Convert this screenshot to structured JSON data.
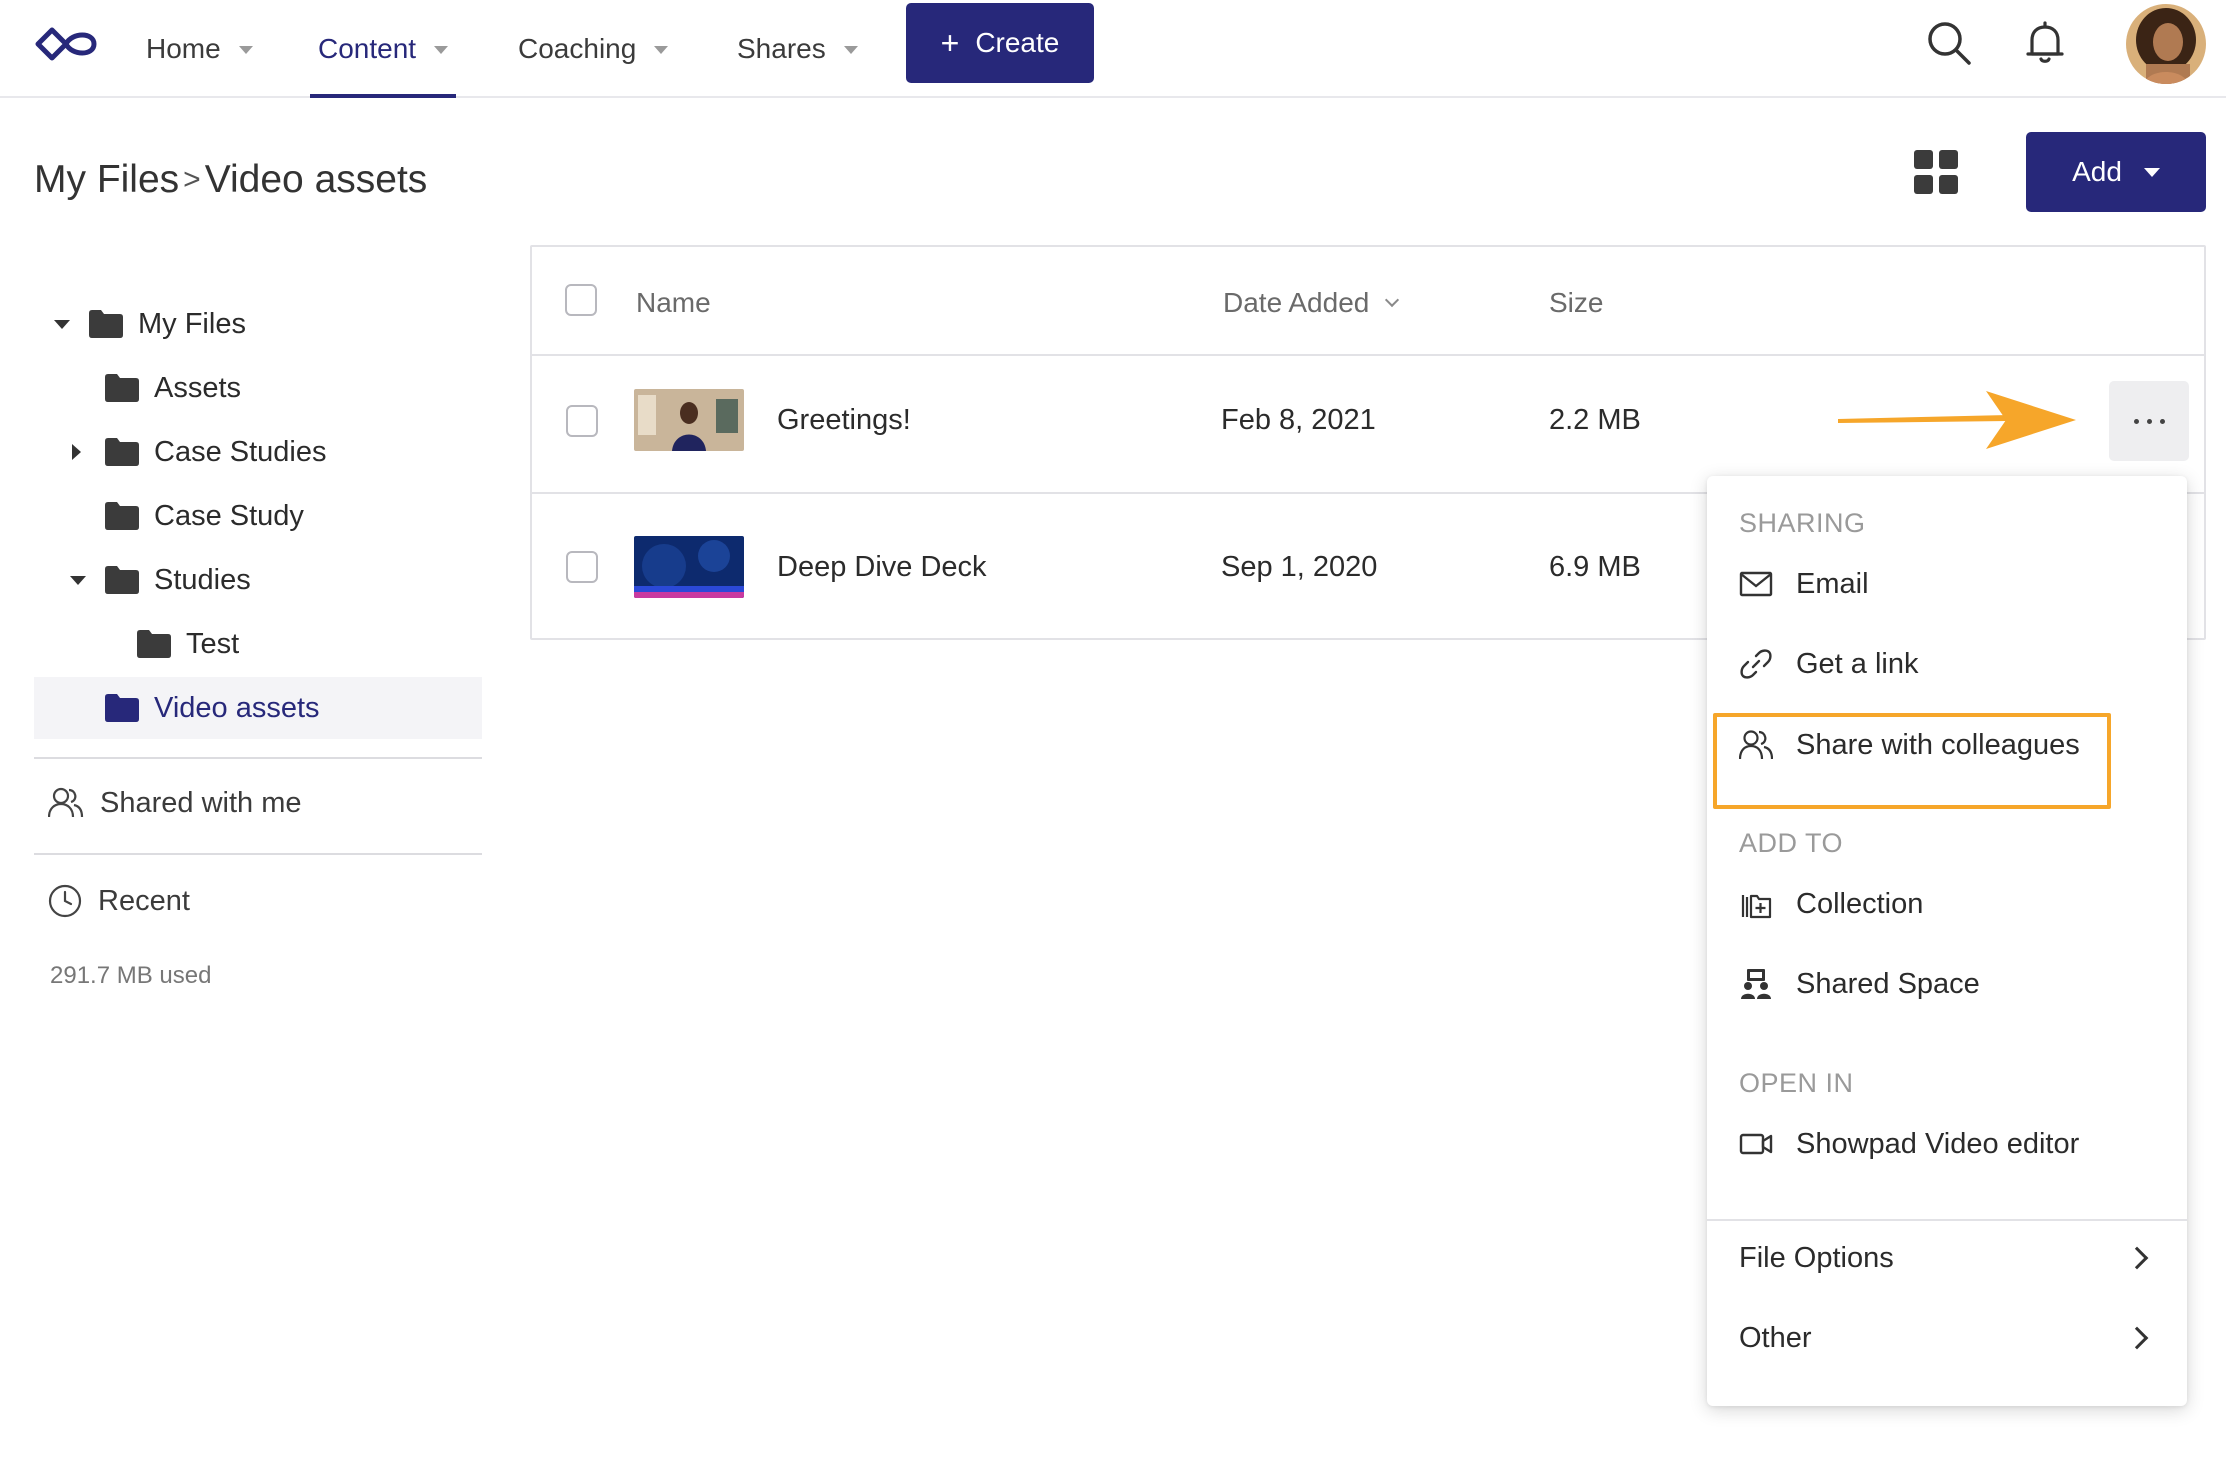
{
  "nav": {
    "items": [
      {
        "label": "Home",
        "active": false
      },
      {
        "label": "Content",
        "active": true
      },
      {
        "label": "Coaching",
        "active": false
      },
      {
        "label": "Shares",
        "active": false
      }
    ],
    "create_label": "Create",
    "accent_color": "#27287a"
  },
  "header": {
    "breadcrumb_root": "My Files",
    "breadcrumb_separator": ">",
    "breadcrumb_current": "Video assets",
    "add_label": "Add"
  },
  "sidebar": {
    "tree": [
      {
        "label": "My Files",
        "expanded": true
      },
      {
        "label": "Assets"
      },
      {
        "label": "Case Studies",
        "expanded": false
      },
      {
        "label": "Case Study"
      },
      {
        "label": "Studies",
        "expanded": true
      },
      {
        "label": "Test"
      },
      {
        "label": "Video assets",
        "selected": true
      }
    ],
    "shared_label": "Shared with me",
    "recent_label": "Recent",
    "usage": "291.7 MB used"
  },
  "table": {
    "columns": {
      "name": "Name",
      "date": "Date Added",
      "size": "Size"
    },
    "rows": [
      {
        "name": "Greetings!",
        "date": "Feb 8, 2021",
        "size": "2.2 MB"
      },
      {
        "name": "Deep Dive Deck",
        "date": "Sep 1, 2020",
        "size": "6.9 MB"
      }
    ]
  },
  "menu": {
    "sharing_header": "SHARING",
    "email": "Email",
    "get_link": "Get a link",
    "share_colleagues": "Share with colleagues",
    "add_to_header": "ADD TO",
    "collection": "Collection",
    "shared_space": "Shared Space",
    "open_in_header": "OPEN IN",
    "video_editor": "Showpad Video editor",
    "file_options": "File Options",
    "other": "Other",
    "highlight_color": "#f6a62a"
  }
}
